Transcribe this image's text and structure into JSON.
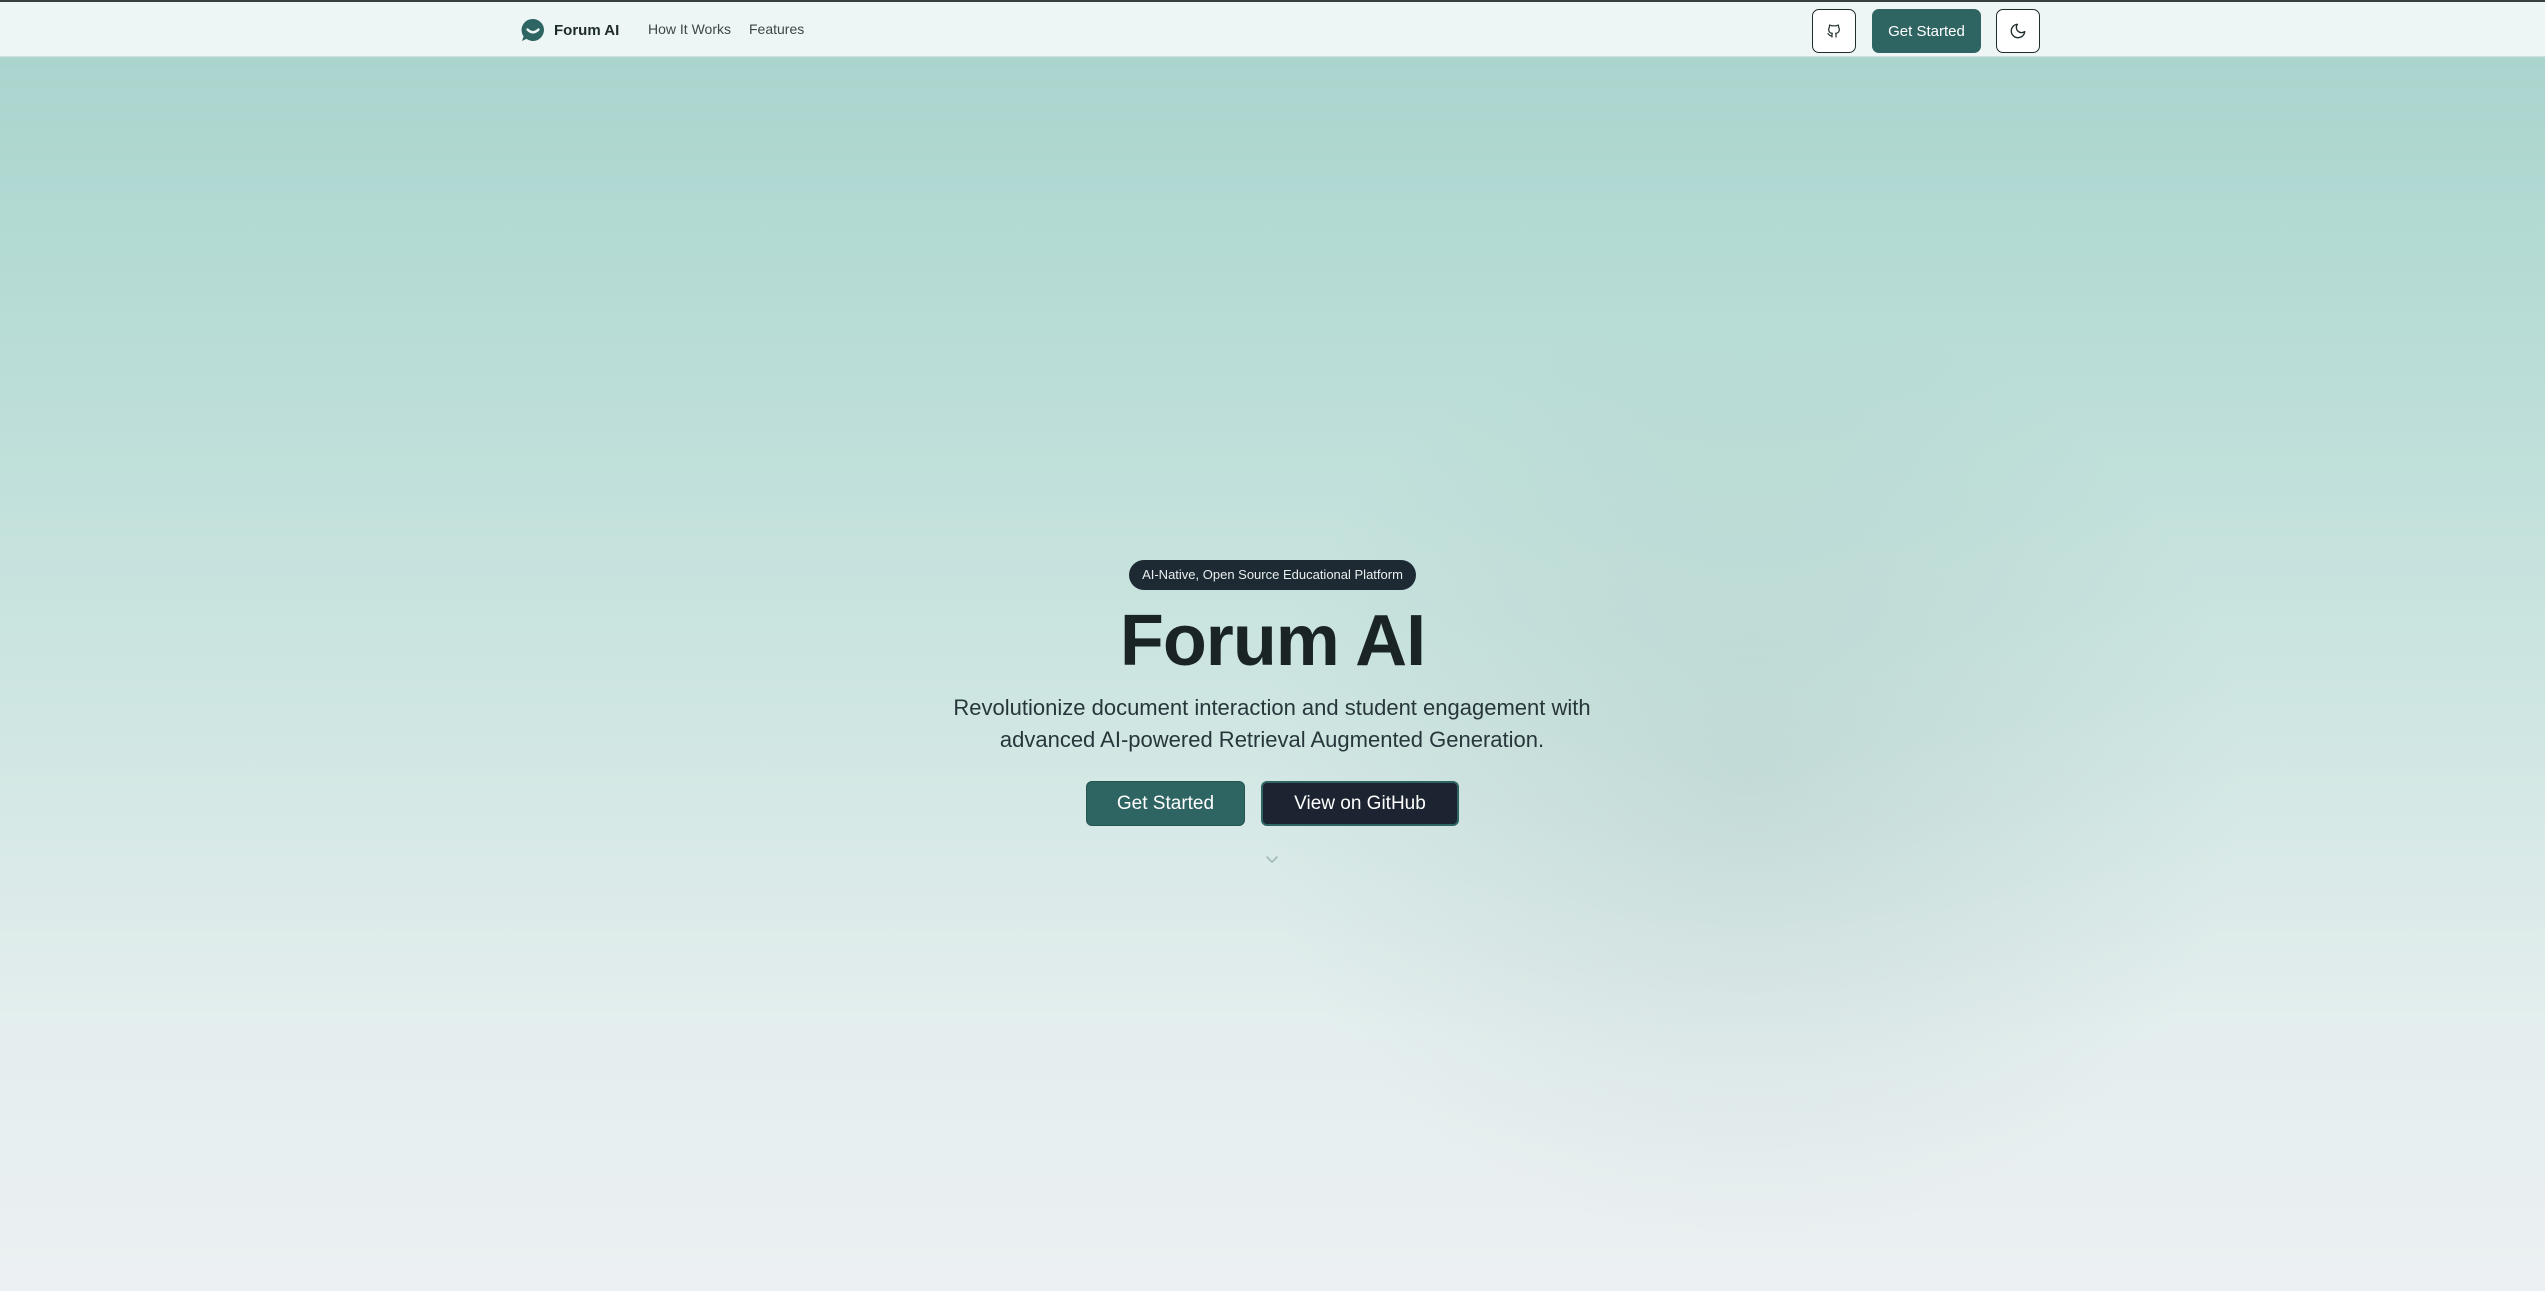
{
  "nav": {
    "brand": "Forum AI",
    "links": [
      "How It Works",
      "Features"
    ],
    "cta_label": "Get Started"
  },
  "hero": {
    "badge": "AI-Native, Open Source Educational Platform",
    "title": "Forum AI",
    "subtitle_line1": "Revolutionize document interaction and student engagement with",
    "subtitle_line2": "advanced AI-powered Retrieval Augmented Generation.",
    "primary_button": "Get Started",
    "secondary_button": "View on GitHub"
  },
  "icons": {
    "logo": "chat-bubble-smile-icon",
    "github": "github-icon",
    "theme": "moon-icon",
    "scroll": "chevron-down-icon"
  },
  "colors": {
    "accent": "#2e6461",
    "dark": "#1b2430",
    "text": "#1a2424"
  }
}
